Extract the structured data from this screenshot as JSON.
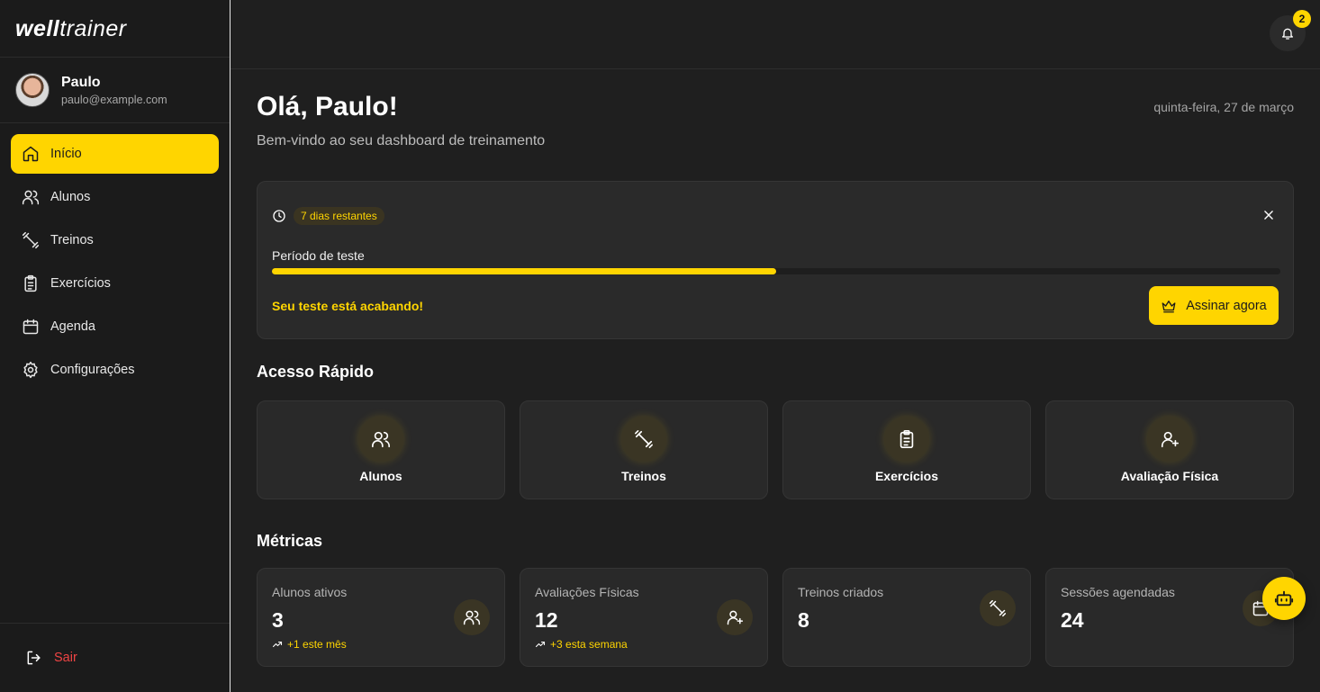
{
  "brand": {
    "bold": "well",
    "light": "trainer"
  },
  "user": {
    "name": "Paulo",
    "email": "paulo@example.com"
  },
  "nav": [
    {
      "label": "Início",
      "icon": "home-icon",
      "active": true
    },
    {
      "label": "Alunos",
      "icon": "users-icon",
      "active": false
    },
    {
      "label": "Treinos",
      "icon": "dumbbell-icon",
      "active": false
    },
    {
      "label": "Exercícios",
      "icon": "clipboard-icon",
      "active": false
    },
    {
      "label": "Agenda",
      "icon": "calendar-icon",
      "active": false
    },
    {
      "label": "Configurações",
      "icon": "gear-icon",
      "active": false
    }
  ],
  "logout_label": "Sair",
  "notifications": {
    "count": "2"
  },
  "header": {
    "greeting": "Olá, Paulo!",
    "subtitle": "Bem-vindo ao seu dashboard de treinamento",
    "date": "quinta-feira, 27 de março"
  },
  "trial": {
    "badge": "7 dias restantes",
    "label": "Período de teste",
    "progress_fraction": 0.5,
    "warning": "Seu teste está acabando!",
    "button": "Assinar agora"
  },
  "quick_access": {
    "title": "Acesso Rápido",
    "items": [
      {
        "label": "Alunos",
        "icon": "users-icon"
      },
      {
        "label": "Treinos",
        "icon": "dumbbell-icon"
      },
      {
        "label": "Exercícios",
        "icon": "clipboard-icon"
      },
      {
        "label": "Avaliação Física",
        "icon": "user-plus-icon"
      }
    ]
  },
  "metrics": {
    "title": "Métricas",
    "items": [
      {
        "label": "Alunos ativos",
        "value": "3",
        "trend": "+1 este mês",
        "icon": "users-icon"
      },
      {
        "label": "Avaliações Físicas",
        "value": "12",
        "trend": "+3 esta semana",
        "icon": "user-plus-icon"
      },
      {
        "label": "Treinos criados",
        "value": "8",
        "trend": "",
        "icon": "dumbbell-icon"
      },
      {
        "label": "Sessões agendadas",
        "value": "24",
        "trend": "",
        "icon": "calendar-icon"
      }
    ]
  },
  "colors": {
    "accent": "#ffd500",
    "danger": "#ef4444",
    "background": "#1f1f1f",
    "card": "#292929"
  }
}
